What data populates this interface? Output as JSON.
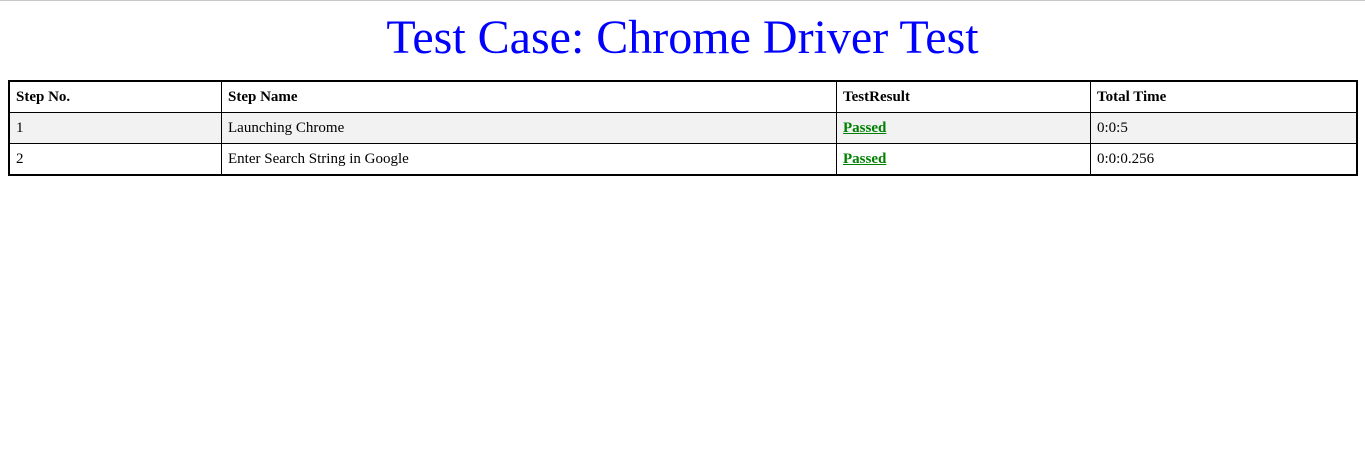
{
  "page": {
    "title": "Test Case: Chrome Driver Test",
    "title_color": "#0000ff"
  },
  "table": {
    "headers": {
      "step_no": "Step No.",
      "step_name": "Step Name",
      "test_result": "TestResult",
      "total_time": "Total Time"
    },
    "rows": [
      {
        "step_no": "1",
        "step_name": "Launching Chrome",
        "result": "Passed",
        "total_time": "0:0:5"
      },
      {
        "step_no": "2",
        "step_name": "Enter Search String in Google",
        "result": "Passed",
        "total_time": "0:0:0.256"
      }
    ],
    "colors": {
      "passed": "#008000",
      "odd_row_bg": "#f2f2f2"
    }
  }
}
